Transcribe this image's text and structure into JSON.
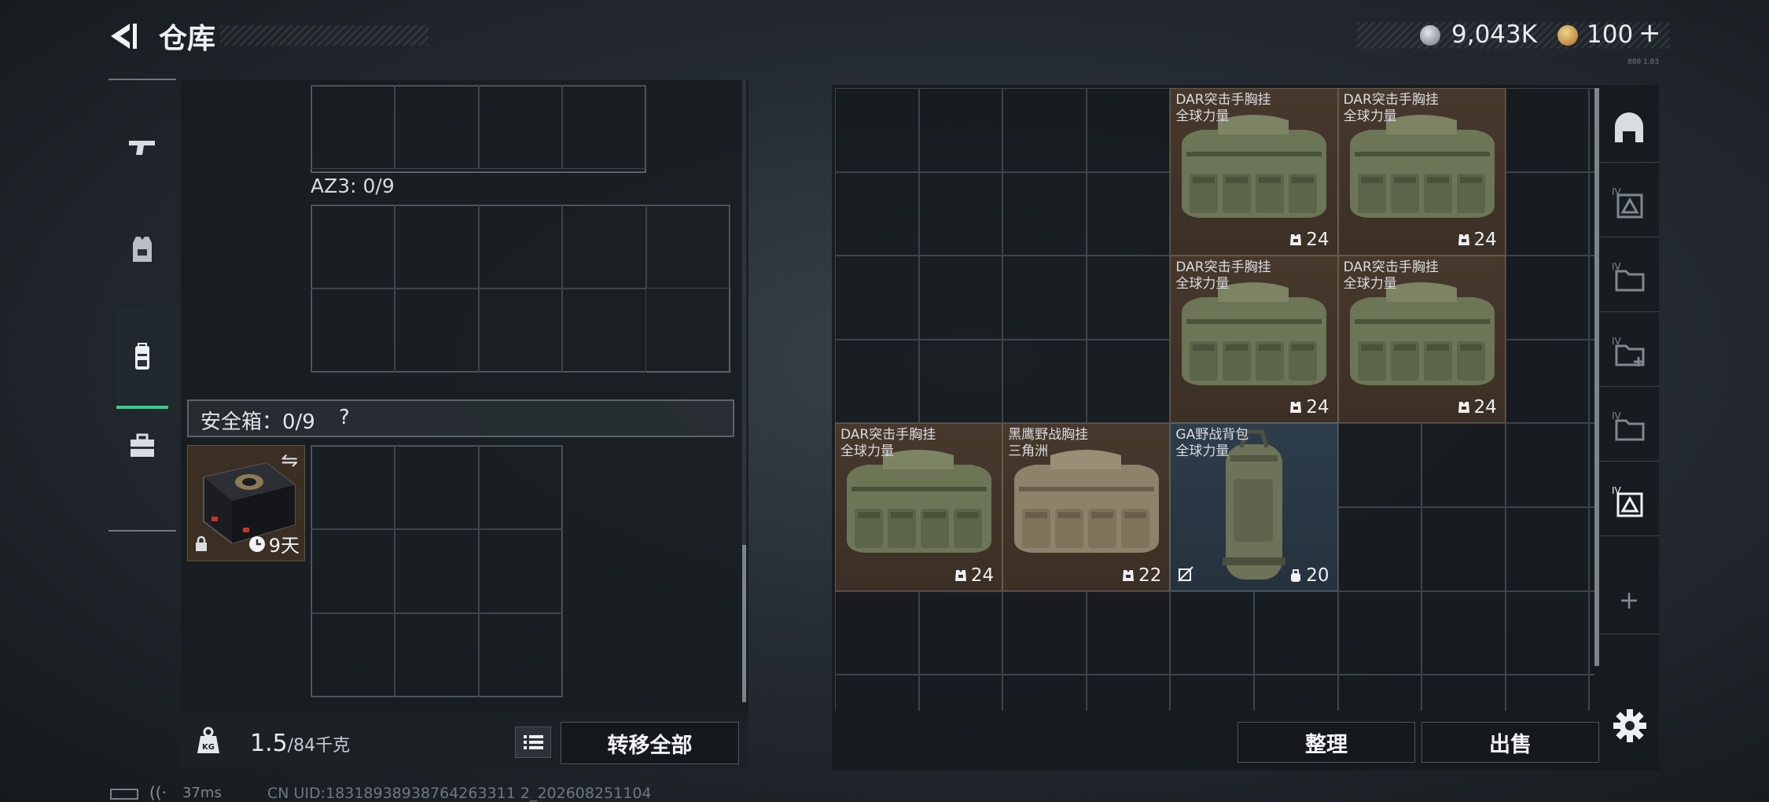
{
  "header": {
    "title": "仓库",
    "money": "9,043K",
    "premium": "100",
    "plus": "+",
    "corner_text": "888 1.83"
  },
  "colors": {
    "accent_green": "#2fd38a",
    "item_brown": "#45362a",
    "item_blue": "#2c3a47"
  },
  "left_tabs": [
    {
      "name": "weapon",
      "icon": "pistol-icon"
    },
    {
      "name": "armor",
      "icon": "armor-vest-icon"
    },
    {
      "name": "backpack",
      "icon": "backpack-icon",
      "selected": true
    },
    {
      "name": "case",
      "icon": "toolbox-icon"
    }
  ],
  "loadout": {
    "az3_label": "AZ3: 0/9",
    "safe_label": "安全箱：0/9",
    "safe_help": "?",
    "safe_box_timer": "9天",
    "weight": "1.5",
    "weight_max": "/84千克",
    "transfer_all": "转移全部"
  },
  "stash": {
    "items": [
      {
        "name": "DAR突击手胸挂",
        "brand": "全球力量",
        "stat": "24",
        "stat_icon": "armor-icon"
      },
      {
        "name": "DAR突击手胸挂",
        "brand": "全球力量",
        "stat": "24",
        "stat_icon": "armor-icon"
      },
      {
        "name": "DAR突击手胸挂",
        "brand": "全球力量",
        "stat": "24",
        "stat_icon": "armor-icon"
      },
      {
        "name": "DAR突击手胸挂",
        "brand": "全球力量",
        "stat": "24",
        "stat_icon": "armor-icon"
      },
      {
        "name": "DAR突击手胸挂",
        "brand": "全球力量",
        "stat": "24",
        "stat_icon": "armor-icon"
      },
      {
        "name": "黑鹰野战胸挂",
        "brand": "三角洲",
        "stat": "22",
        "stat_icon": "armor-icon"
      },
      {
        "name": "GA野战背包",
        "brand": "全球力量",
        "stat": "20",
        "stat_icon": "bag-icon"
      }
    ],
    "sort_label": "整理",
    "sell_label": "出售"
  },
  "right_tabs": [
    {
      "icon": "stash-home-icon",
      "label": ""
    },
    {
      "icon": "container-icon",
      "label": "IV"
    },
    {
      "icon": "folder-icon",
      "label": "IV"
    },
    {
      "icon": "folder-add-icon",
      "label": "IV"
    },
    {
      "icon": "folder-icon",
      "label": "IV"
    },
    {
      "icon": "container-icon",
      "label": "IV",
      "selected": true
    },
    {
      "icon": "plus-icon",
      "label": "+"
    }
  ],
  "footer": {
    "ping": "37ms",
    "uid": "CN UID:18318938938764263311 2_202608251104"
  }
}
